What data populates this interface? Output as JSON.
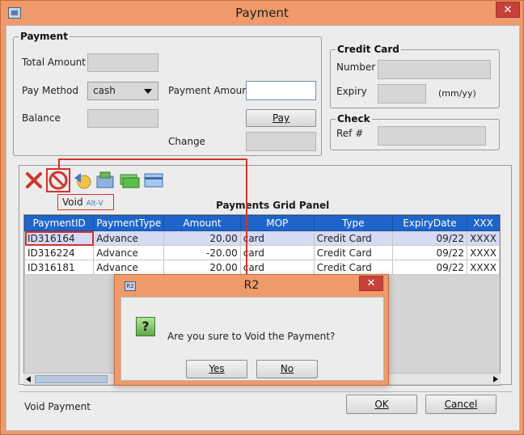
{
  "window": {
    "title": "Payment",
    "close_glyph": "✕"
  },
  "payment_group": {
    "legend": "Payment",
    "total_amount_label": "Total Amount",
    "pay_method_label": "Pay Method",
    "pay_method_value": "cash",
    "balance_label": "Balance",
    "payment_amount_label": "Payment Amount",
    "payment_amount_value": "",
    "pay_button": "Pay",
    "change_label": "Change"
  },
  "credit_card": {
    "legend": "Credit Card",
    "number_label": "Number",
    "expiry_label": "Expiry",
    "expiry_format": "(mm/yy)"
  },
  "check": {
    "legend": "Check",
    "ref_label": "Ref #"
  },
  "toolbar": {
    "icons": [
      "delete-icon",
      "void-icon",
      "back-icon",
      "payment-icon",
      "cash-icon",
      "card-icon"
    ],
    "void_hint": "Void",
    "void_shortcut": "Alt-V"
  },
  "grid": {
    "title": "Payments Grid Panel",
    "columns": [
      "PaymentID",
      "PaymentType",
      "Amount",
      "MOP",
      "Type",
      "ExpiryDate",
      "XXX"
    ],
    "rows": [
      [
        "ID316164",
        "Advance",
        "20.00",
        "card",
        "Credit Card",
        "09/22",
        "XXXX"
      ],
      [
        "ID316224",
        "Advance",
        "-20.00",
        "card",
        "Credit Card",
        "09/22",
        "XXXX"
      ],
      [
        "ID316181",
        "Advance",
        "20.00",
        "card",
        "Credit Card",
        "09/22",
        "XXXX"
      ]
    ],
    "selected_row": 0
  },
  "status": {
    "text": "Void Payment",
    "ok_button": "OK",
    "cancel_button": "Cancel"
  },
  "dialog": {
    "title": "R2",
    "icon_text": "R2",
    "question_glyph": "?",
    "message": "Are you sure to Void the Payment?",
    "yes_button": "Yes",
    "no_button": "No",
    "close_glyph": "✕"
  },
  "colors": {
    "accent_frame": "#ee9a6a",
    "highlight": "#d3322d",
    "grid_header": "#1f65c9",
    "selected_row": "#d6daf3"
  }
}
